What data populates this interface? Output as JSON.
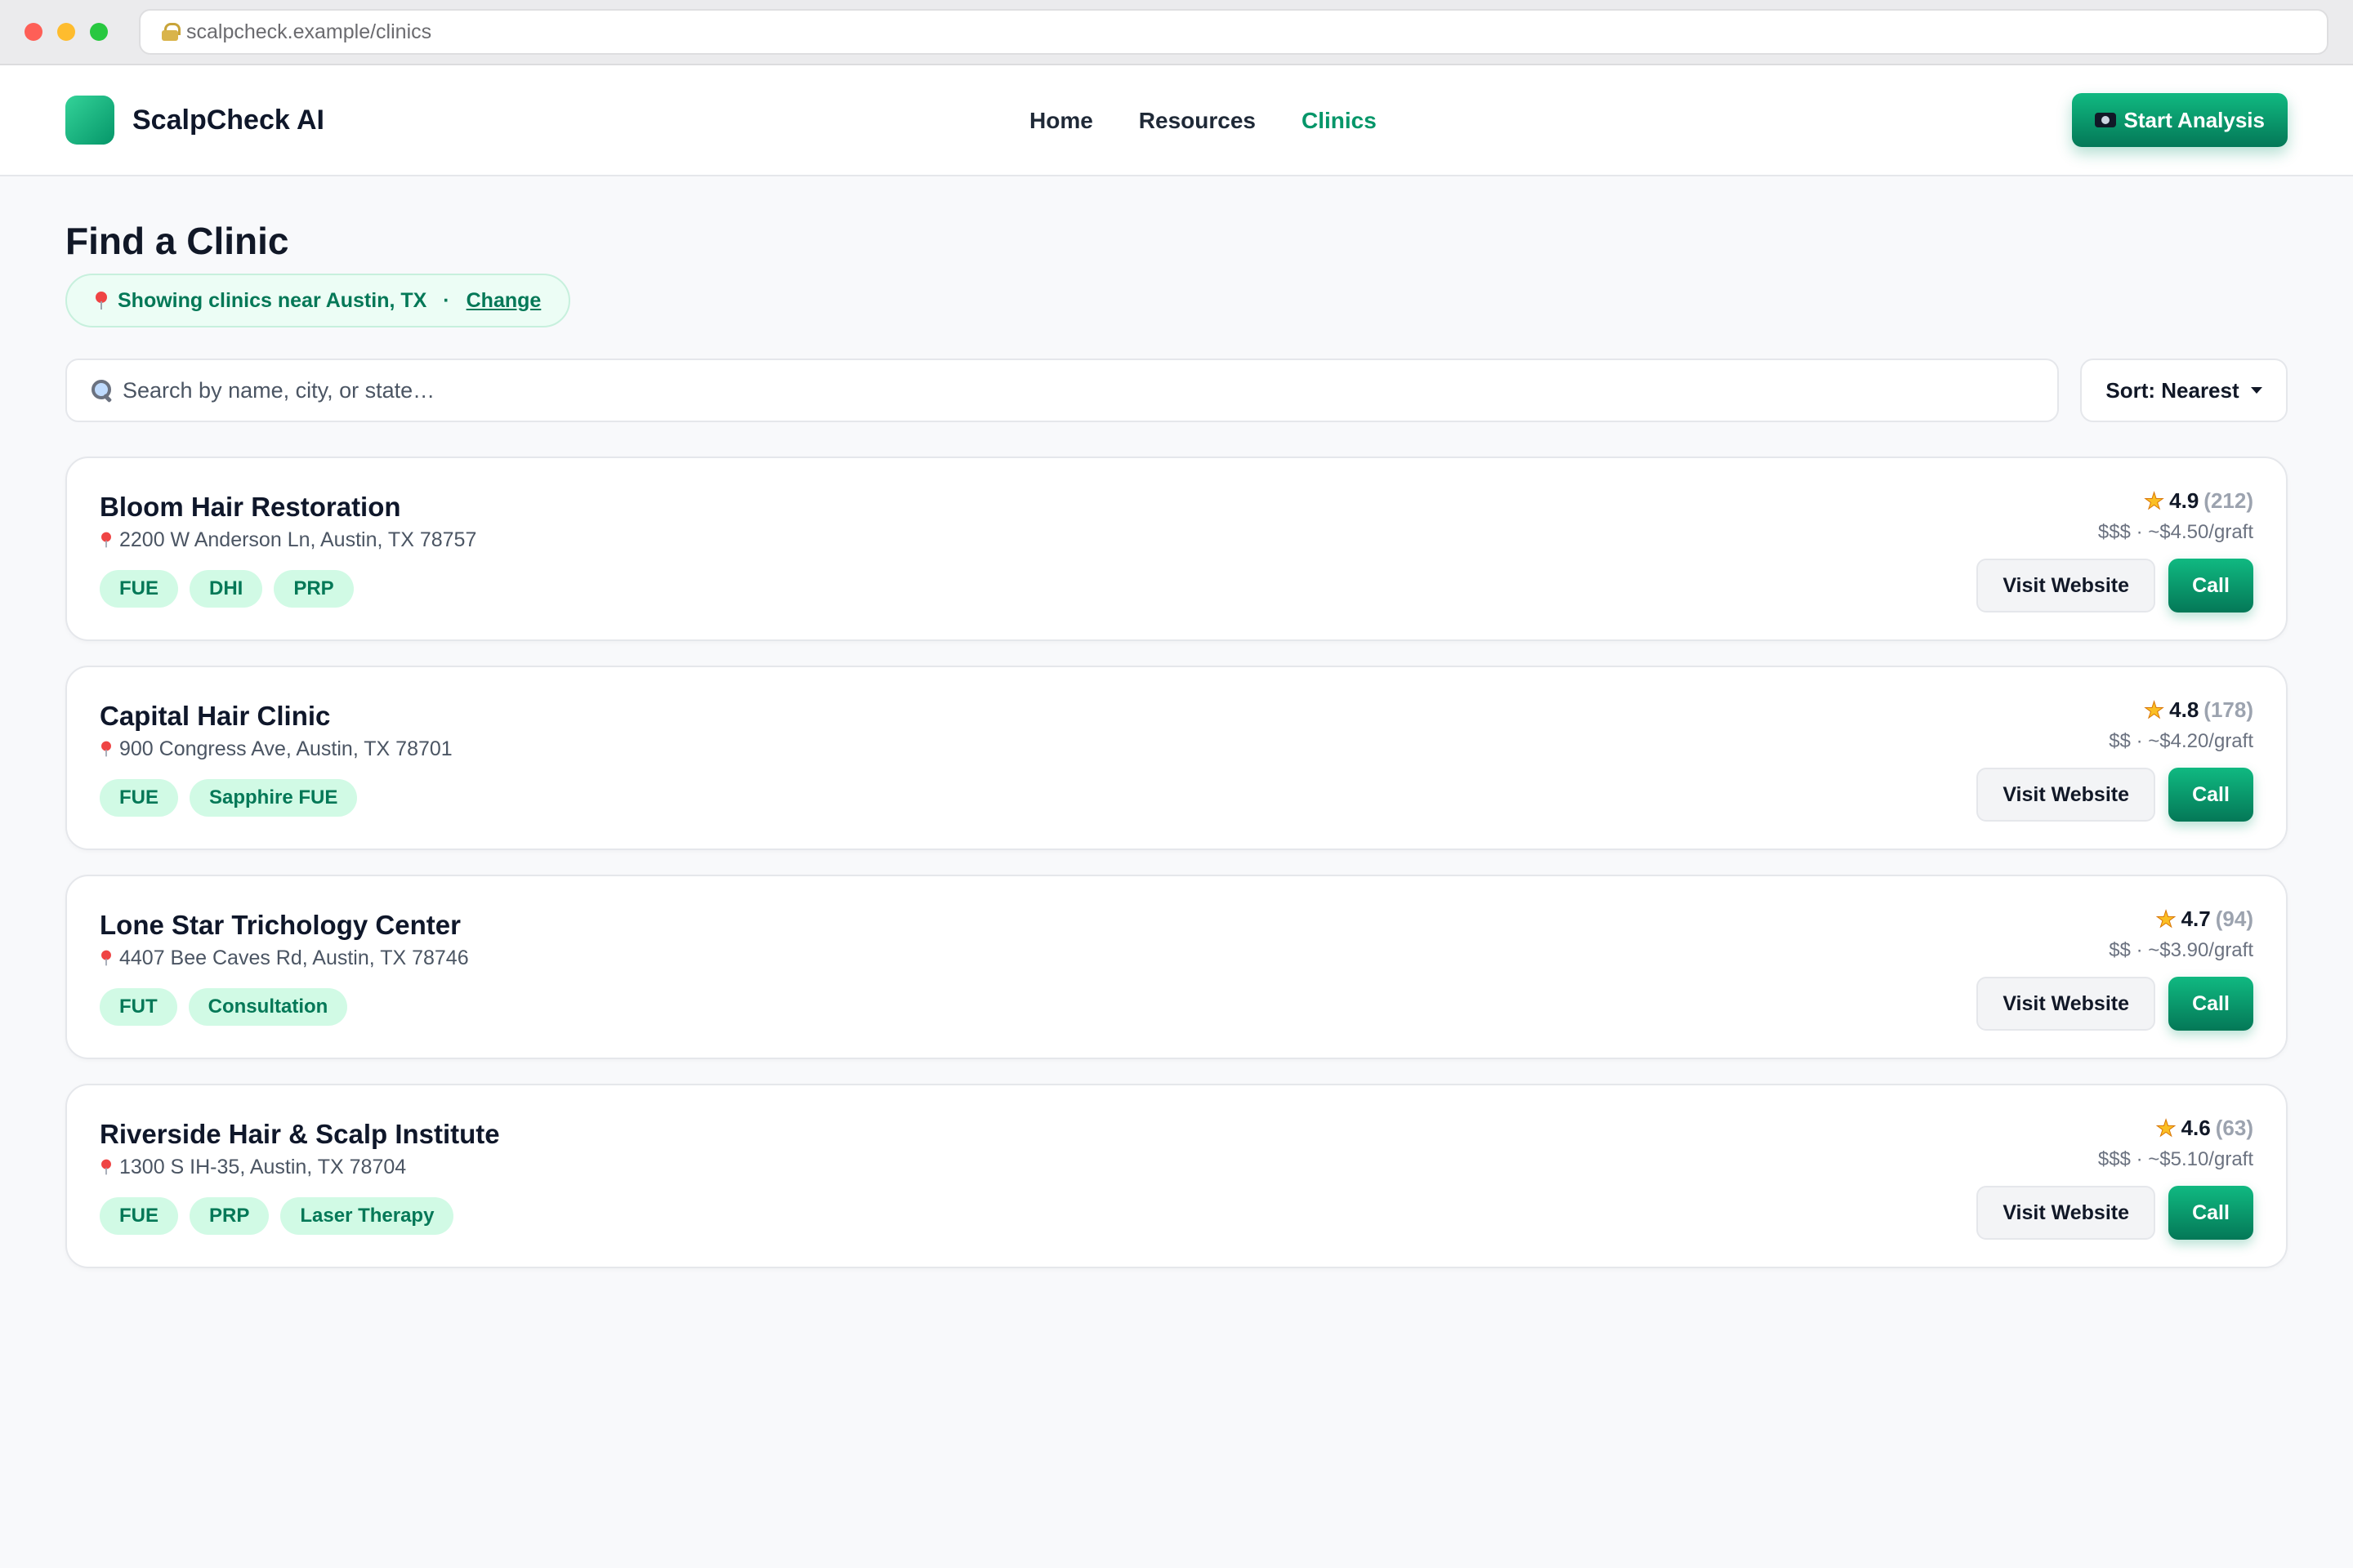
{
  "browser": {
    "url": "scalpcheck.example/clinics"
  },
  "header": {
    "brand": "ScalpCheck AI",
    "nav": [
      {
        "label": "Home",
        "active": false
      },
      {
        "label": "Resources",
        "active": false
      },
      {
        "label": "Clinics",
        "active": true
      }
    ],
    "cta_label": "Start Analysis",
    "cta_icon": "camera-icon"
  },
  "page": {
    "title": "Find a Clinic",
    "location_text": "Showing clinics near Austin, TX",
    "separator": "·",
    "change_label": "Change",
    "search_placeholder": "Search by name, city, or state…",
    "sort_label": "Sort: Nearest"
  },
  "clinics": [
    {
      "name": "Bloom Hair Restoration",
      "address": "2200 W Anderson Ln, Austin, TX 78757",
      "tags": [
        "FUE",
        "DHI",
        "PRP"
      ],
      "rating": "4.9",
      "reviews": "(212)",
      "price": "$$$ · ~$4.50/graft",
      "visit_label": "Visit Website",
      "call_label": "Call"
    },
    {
      "name": "Capital Hair Clinic",
      "address": "900 Congress Ave, Austin, TX 78701",
      "tags": [
        "FUE",
        "Sapphire FUE"
      ],
      "rating": "4.8",
      "reviews": "(178)",
      "price": "$$ · ~$4.20/graft",
      "visit_label": "Visit Website",
      "call_label": "Call"
    },
    {
      "name": "Lone Star Trichology Center",
      "address": "4407 Bee Caves Rd, Austin, TX 78746",
      "tags": [
        "FUT",
        "Consultation"
      ],
      "rating": "4.7",
      "reviews": "(94)",
      "price": "$$ · ~$3.90/graft",
      "visit_label": "Visit Website",
      "call_label": "Call"
    },
    {
      "name": "Riverside Hair & Scalp Institute",
      "address": "1300 S IH-35, Austin, TX 78704",
      "tags": [
        "FUE",
        "PRP",
        "Laser Therapy"
      ],
      "rating": "4.6",
      "reviews": "(63)",
      "price": "$$$ · ~$5.10/graft",
      "visit_label": "Visit Website",
      "call_label": "Call"
    }
  ],
  "colors": {
    "accent": "#059669",
    "accent_light": "#d1fae5",
    "star": "#fbbf24"
  }
}
